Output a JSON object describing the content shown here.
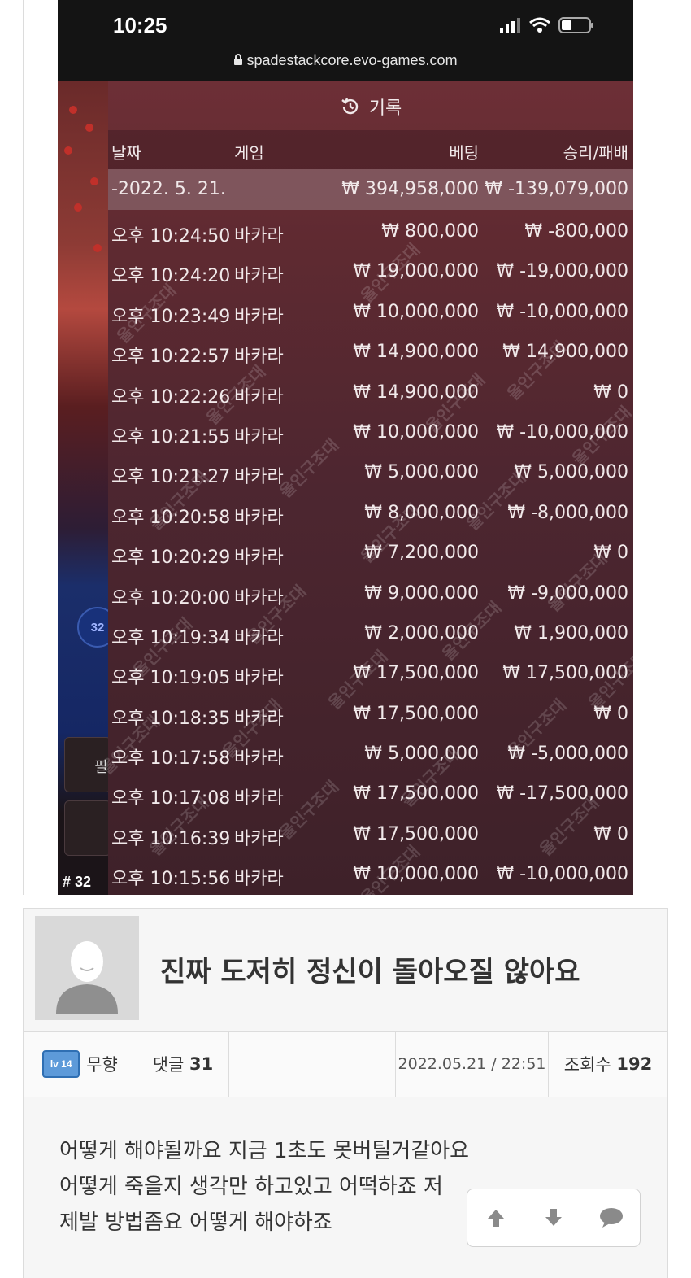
{
  "status_bar": {
    "time": "10:25",
    "url": "spadestackcore.evo-games.com"
  },
  "game_strip": {
    "round_badge": "32",
    "round_number": "# 32",
    "button_glyph": "필"
  },
  "history": {
    "title": "기록",
    "columns": {
      "date": "날짜",
      "game": "게임",
      "bet": "베팅",
      "result": "승리/패배"
    },
    "date_row": {
      "date": "-2022. 5. 21.",
      "total_bet": "₩ 394,958,000",
      "total_result": "₩ -139,079,000"
    },
    "rows": [
      {
        "time": "오후 10:24:50",
        "game": "바카라",
        "bet": "₩ 800,000",
        "result": "₩ -800,000"
      },
      {
        "time": "오후 10:24:20",
        "game": "바카라",
        "bet": "₩ 19,000,000",
        "result": "₩ -19,000,000"
      },
      {
        "time": "오후 10:23:49",
        "game": "바카라",
        "bet": "₩ 10,000,000",
        "result": "₩ -10,000,000"
      },
      {
        "time": "오후 10:22:57",
        "game": "바카라",
        "bet": "₩ 14,900,000",
        "result": "₩ 14,900,000"
      },
      {
        "time": "오후 10:22:26",
        "game": "바카라",
        "bet": "₩ 14,900,000",
        "result": "₩ 0"
      },
      {
        "time": "오후 10:21:55",
        "game": "바카라",
        "bet": "₩ 10,000,000",
        "result": "₩ -10,000,000"
      },
      {
        "time": "오후 10:21:27",
        "game": "바카라",
        "bet": "₩ 5,000,000",
        "result": "₩ 5,000,000"
      },
      {
        "time": "오후 10:20:58",
        "game": "바카라",
        "bet": "₩ 8,000,000",
        "result": "₩ -8,000,000"
      },
      {
        "time": "오후 10:20:29",
        "game": "바카라",
        "bet": "₩ 7,200,000",
        "result": "₩ 0"
      },
      {
        "time": "오후 10:20:00",
        "game": "바카라",
        "bet": "₩ 9,000,000",
        "result": "₩ -9,000,000"
      },
      {
        "time": "오후 10:19:34",
        "game": "바카라",
        "bet": "₩ 2,000,000",
        "result": "₩ 1,900,000"
      },
      {
        "time": "오후 10:19:05",
        "game": "바카라",
        "bet": "₩ 17,500,000",
        "result": "₩ 17,500,000"
      },
      {
        "time": "오후 10:18:35",
        "game": "바카라",
        "bet": "₩ 17,500,000",
        "result": "₩ 0"
      },
      {
        "time": "오후 10:17:58",
        "game": "바카라",
        "bet": "₩ 5,000,000",
        "result": "₩ -5,000,000"
      },
      {
        "time": "오후 10:17:08",
        "game": "바카라",
        "bet": "₩ 17,500,000",
        "result": "₩ -17,500,000"
      },
      {
        "time": "오후 10:16:39",
        "game": "바카라",
        "bet": "₩ 17,500,000",
        "result": "₩ 0"
      },
      {
        "time": "오후 10:15:56",
        "game": "바카라",
        "bet": "₩ 10,000,000",
        "result": "₩ -10,000,000"
      }
    ],
    "watermark": "올인구조대"
  },
  "post": {
    "title": "진짜 도저히 정신이 돌아오질 않아요",
    "author": {
      "level": "lv 14",
      "name": "무향"
    },
    "comments": {
      "label": "댓글",
      "count": "31"
    },
    "datetime": "2022.05.21 / 22:51",
    "views": {
      "label": "조회수",
      "count": "192"
    },
    "body": [
      "어떻게 해야될까요 지금 1초도 못버틸거같아요",
      "어떻게 죽을지 생각만 하고있고 어떡하죠 저",
      "제발 방법좀요 어떻게 해야하죠"
    ],
    "actions": {
      "up_icon": "arrow-up-icon",
      "down_icon": "arrow-down-icon",
      "comment_icon": "speech-bubble-icon"
    }
  },
  "colors": {
    "panel_top": "#6d2f36",
    "panel_bottom": "#3e2129",
    "level_badge": "#5d9ad9"
  }
}
